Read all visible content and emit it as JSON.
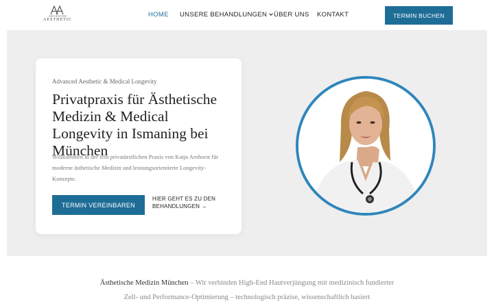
{
  "header": {
    "logo_monogram": "AA",
    "logo_sub": "ADVANCED",
    "logo_brand": "AESTHETIC",
    "nav": {
      "home": "HOME",
      "treatments": "UNSERE BEHANDLUNGEN",
      "about": "ÜBER UNS",
      "contact": "KONTAKT"
    },
    "cta": "TERMIN BUCHEN"
  },
  "hero": {
    "eyebrow": "Advanced Aesthetic & Medical Longevity",
    "title": "Privatpraxis für Ästhetische Medizin & Medical Longevity in Ismaning bei München",
    "description": "Willkommen in der rein privatärztlichen Praxis von Katja Arnhorst für moderne ästhetische Medizin und leistungsorientierte Longevity-Konzepte.",
    "primary_button": "TERMIN VEREINBAREN",
    "secondary_link": "HIER GEHT ES ZU DEN BEHANDLUNGEN →"
  },
  "intro": {
    "lead": "Ästhetische Medizin München",
    "text": " – Wir verbinden High-End Hautverjüngung mit medizinisch fundierter Zell- und Performance-Optimierung – technologisch präzise, wissenschaftlich basiert"
  },
  "colors": {
    "accent": "#1e6d97",
    "portrait_ring": "#2f86bb",
    "hero_background": "#eeeeee"
  },
  "icons": {
    "dropdown": "chevron-down-icon",
    "link_arrow": "arrow-right-icon"
  }
}
